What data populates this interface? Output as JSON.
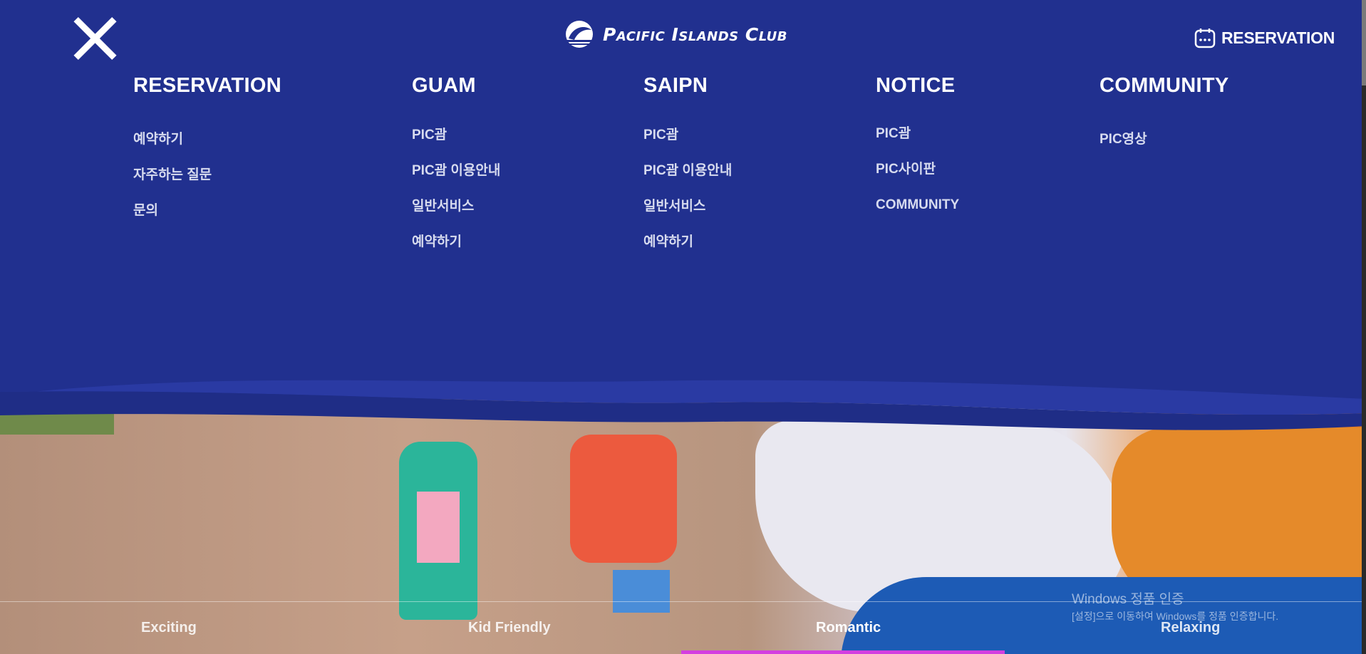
{
  "header": {
    "logo_text": "Pacific Islands Club",
    "reservation_label": "RESERVATION"
  },
  "menu": {
    "columns": [
      {
        "title": "RESERVATION",
        "items": [
          "예약하기",
          "자주하는 질문",
          "문의"
        ]
      },
      {
        "title": "GUAM",
        "items": [
          "PIC괌",
          "PIC괌 이용안내",
          "일반서비스",
          "예약하기"
        ]
      },
      {
        "title": "SAIPN",
        "items": [
          "PIC괌",
          "PIC괌 이용안내",
          "일반서비스",
          "예약하기"
        ]
      },
      {
        "title": "NOTICE",
        "items": [
          "PIC괌",
          "PIC사이판",
          "COMMUNITY"
        ]
      },
      {
        "title": "COMMUNITY",
        "items": [
          "PIC영상"
        ]
      }
    ]
  },
  "tabs": [
    {
      "label": "Exciting",
      "active": false
    },
    {
      "label": "Kid Friendly",
      "active": false
    },
    {
      "label": "Romantic",
      "active": true
    },
    {
      "label": "Relaxing",
      "active": false
    }
  ],
  "windows_notice": {
    "title": "Windows 정품 인증",
    "subtitle": "[설정]으로 이동하여 Windows를 정품 인증합니다."
  },
  "colors": {
    "panel_bg": "#21308f",
    "accent_underline": "#d43fe0",
    "menu_item": "#d7dbef"
  },
  "icons": {
    "close": "close-icon",
    "calendar": "calendar-icon",
    "logo": "pic-logo-icon"
  }
}
